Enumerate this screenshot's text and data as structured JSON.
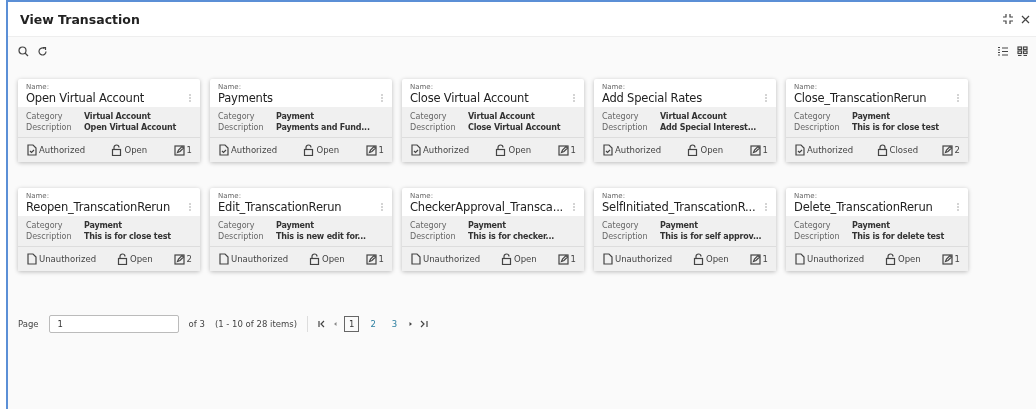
{
  "window": {
    "title": "View Transaction"
  },
  "cards": [
    {
      "name_label": "Name:",
      "name": "Open Virtual Account",
      "category_label": "Category",
      "category": "Virtual Account",
      "description_label": "Description",
      "description": "Open Virtual Account",
      "auth_status": "Authorized",
      "authorized": true,
      "lock_status": "Open",
      "locked": false,
      "edit_count": "1"
    },
    {
      "name_label": "Name:",
      "name": "Payments",
      "category_label": "Category",
      "category": "Payment",
      "description_label": "Description",
      "description": "Payments and Fund...",
      "auth_status": "Authorized",
      "authorized": true,
      "lock_status": "Open",
      "locked": false,
      "edit_count": "1"
    },
    {
      "name_label": "Name:",
      "name": "Close Virtual Account",
      "category_label": "Category",
      "category": "Virtual Account",
      "description_label": "Description",
      "description": "Close Virtual Account",
      "auth_status": "Authorized",
      "authorized": true,
      "lock_status": "Open",
      "locked": false,
      "edit_count": "1"
    },
    {
      "name_label": "Name:",
      "name": "Add Special Rates",
      "category_label": "Category",
      "category": "Virtual Account",
      "description_label": "Description",
      "description": "Add Special Interest...",
      "auth_status": "Authorized",
      "authorized": true,
      "lock_status": "Open",
      "locked": false,
      "edit_count": "1"
    },
    {
      "name_label": "Name:",
      "name": "Close_TranscationRerun",
      "category_label": "Category",
      "category": "Payment",
      "description_label": "Description",
      "description": "This is for close test",
      "auth_status": "Authorized",
      "authorized": true,
      "lock_status": "Closed",
      "locked": true,
      "edit_count": "2"
    },
    {
      "name_label": "Name:",
      "name": "Reopen_TranscationRerun",
      "category_label": "Category",
      "category": "Payment",
      "description_label": "Description",
      "description": "This is for close test",
      "auth_status": "Unauthorized",
      "authorized": false,
      "lock_status": "Open",
      "locked": false,
      "edit_count": "2"
    },
    {
      "name_label": "Name:",
      "name": "Edit_TranscationRerun",
      "category_label": "Category",
      "category": "Payment",
      "description_label": "Description",
      "description": "This is new edit for...",
      "auth_status": "Unauthorized",
      "authorized": false,
      "lock_status": "Open",
      "locked": false,
      "edit_count": "1"
    },
    {
      "name_label": "Name:",
      "name": "CheckerApproval_Transca...",
      "category_label": "Category",
      "category": "Payment",
      "description_label": "Description",
      "description": "This is for checker...",
      "auth_status": "Unauthorized",
      "authorized": false,
      "lock_status": "Open",
      "locked": false,
      "edit_count": "1"
    },
    {
      "name_label": "Name:",
      "name": "SelfInitiated_TranscationR...",
      "category_label": "Category",
      "category": "Payment",
      "description_label": "Description",
      "description": "This is for self approv...",
      "auth_status": "Unauthorized",
      "authorized": false,
      "lock_status": "Open",
      "locked": false,
      "edit_count": "1"
    },
    {
      "name_label": "Name:",
      "name": "Delete_TranscationRerun",
      "category_label": "Category",
      "category": "Payment",
      "description_label": "Description",
      "description": "This is for delete test",
      "auth_status": "Unauthorized",
      "authorized": false,
      "lock_status": "Open",
      "locked": false,
      "edit_count": "1"
    }
  ],
  "pagination": {
    "page_label": "Page",
    "page_value": "1",
    "of_pages": "of 3",
    "items_summary": "(1 - 10 of 28 items)",
    "pages": [
      {
        "label": "1",
        "selected": true
      },
      {
        "label": "2",
        "selected": false
      },
      {
        "label": "3",
        "selected": false
      }
    ]
  }
}
